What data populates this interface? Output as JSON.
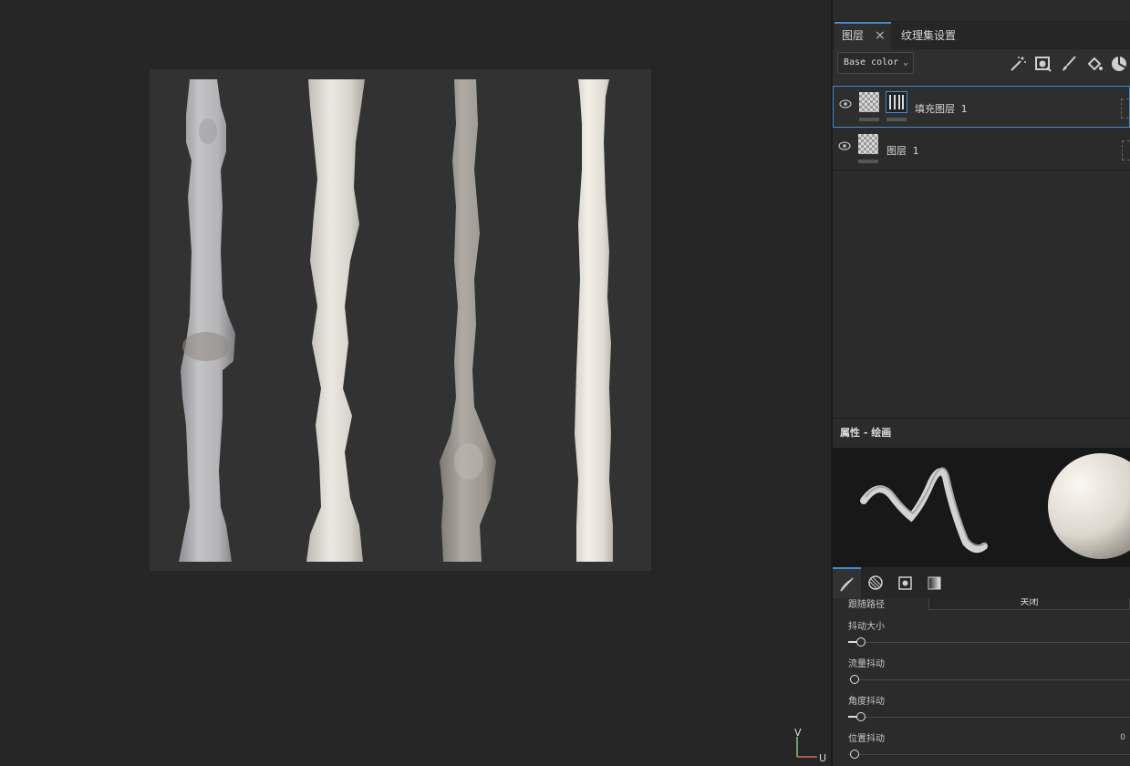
{
  "panel": {
    "tabs": [
      {
        "label": "图层",
        "active": true
      },
      {
        "label": "纹理集设置",
        "active": false
      }
    ],
    "close_glyph": "×",
    "channel_select": "Base color",
    "toolbar_icons": [
      "effects-wand-icon",
      "add-mask-icon",
      "paint-brush-icon",
      "fill-bucket-icon",
      "smart-material-icon"
    ],
    "layers": [
      {
        "name": "填充图层 1",
        "selected": true
      },
      {
        "name": "图层 1",
        "selected": false
      }
    ]
  },
  "properties": {
    "title": "属性 - 绘画",
    "tabs": [
      "brush-tab-icon",
      "alpha-tab-icon",
      "stencil-tab-icon",
      "material-tab-icon"
    ],
    "follow_path": {
      "label": "跟随路径",
      "value": "关闭"
    },
    "params": [
      {
        "label": "抖动大小",
        "value": ""
      },
      {
        "label": "流量抖动",
        "value": ""
      },
      {
        "label": "角度抖动",
        "value": ""
      },
      {
        "label": "位置抖动",
        "value": "0"
      }
    ]
  },
  "viewport": {
    "axis_v": "V",
    "axis_u": "U"
  },
  "colors": {
    "accent": "#3d8fd6",
    "panel_bg": "#2b2b2b",
    "viewport_bg": "#262626"
  }
}
